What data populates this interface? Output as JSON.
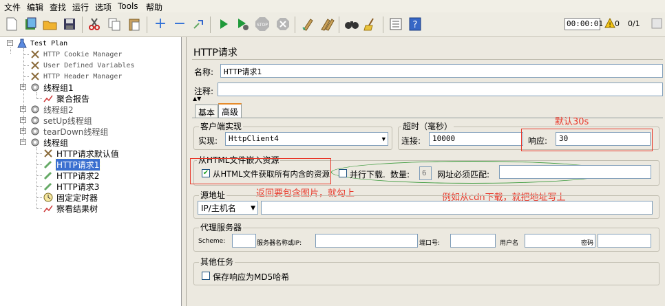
{
  "menu": [
    "文件",
    "编辑",
    "查找",
    "运行",
    "选项",
    "Tools",
    "帮助"
  ],
  "toolbar": {
    "icons": [
      "new-icon",
      "templates-icon",
      "open-icon",
      "save-icon",
      "cut-icon",
      "copy-icon",
      "paste-icon",
      "expand-icon",
      "collapse-icon",
      "toggle-icon",
      "start-icon",
      "start-no-pause-icon",
      "stop-icon",
      "shutdown-icon",
      "clear-icon",
      "clear-all-icon",
      "search-icon",
      "reset-search-icon",
      "function-helper-icon",
      "help-icon"
    ],
    "timer": "00:00:01",
    "warn_count": "0",
    "thread_count": "0/1"
  },
  "tree": {
    "items": [
      {
        "label": "Test Plan"
      },
      {
        "label": "HTTP Cookie Manager"
      },
      {
        "label": "User Defined Variables"
      },
      {
        "label": "HTTP Header Manager"
      },
      {
        "label": "线程组1"
      },
      {
        "label": "聚合报告"
      },
      {
        "label": "线程组2"
      },
      {
        "label": "setUp线程组"
      },
      {
        "label": "tearDown线程组"
      },
      {
        "label": "线程组"
      },
      {
        "label": "HTTP请求默认值"
      },
      {
        "label": "HTTP请求1"
      },
      {
        "label": "HTTP请求2"
      },
      {
        "label": "HTTP请求3"
      },
      {
        "label": "固定定时器"
      },
      {
        "label": "察看结果树"
      }
    ]
  },
  "panel": {
    "title": "HTTP请求",
    "name_label": "名称:",
    "name_value": "HTTP请求1",
    "comment_label": "注释:",
    "comment_value": "",
    "tabs": [
      "基本",
      "高级"
    ],
    "client_group": "客户端实现",
    "impl_label": "实现:",
    "impl_value": "HttpClient4",
    "timeout_group": "超时（毫秒）",
    "connect_label": "连接:",
    "connect_value": "10000",
    "response_label": "响应:",
    "response_value": "30",
    "embedded_group": "从HTML文件嵌入资源",
    "retrieve_all_label": "从HTML文件获取所有内含的资源",
    "retrieve_all_checked": true,
    "parallel_label": "并行下载.",
    "parallel_checked": false,
    "count_label": "数量:",
    "count_value": "6",
    "urls_match_label": "网址必须匹配:",
    "urls_match_value": "",
    "source_group": "源地址",
    "source_type": "IP/主机名",
    "source_value": "",
    "proxy_group": "代理服务器",
    "scheme_label": "Scheme:",
    "scheme_value": "",
    "server_label": "服务器名称或IP:",
    "server_value": "",
    "port_label": "端口号:",
    "port_value": "",
    "user_label": "用户名",
    "user_value": "",
    "pass_label": "密码",
    "pass_value": "",
    "other_group": "其他任务",
    "md5_label": "保存响应为MD5哈希",
    "md5_checked": false
  },
  "annotations": {
    "default_30s": "默认30s",
    "include_images": "返回要包含图片，就勾上",
    "cdn_hint": "例如从cdn下载，就把地址写上"
  },
  "colors": {
    "annotation": "#e8392b",
    "ellipse": "#3b9a3b",
    "selection": "#3a6fd0",
    "tab_accent": "#e68b2c"
  }
}
